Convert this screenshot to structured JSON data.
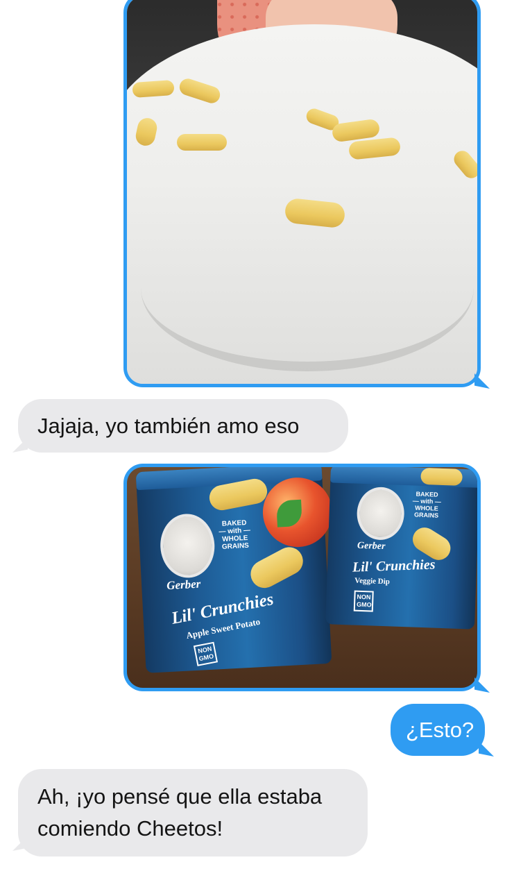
{
  "conversation": {
    "messages": [
      {
        "side": "outgoing",
        "type": "photo",
        "label": ""
      },
      {
        "side": "incoming",
        "type": "text",
        "text": "Jajaja, yo también amo eso"
      },
      {
        "side": "outgoing",
        "type": "photo",
        "label": ""
      },
      {
        "side": "outgoing",
        "type": "text",
        "text": "¿Esto?"
      },
      {
        "side": "incoming",
        "type": "text",
        "text": "Ah, ¡yo pensé que ella estaba comiendo Cheetos!"
      }
    ]
  },
  "product_photo": {
    "left_can": {
      "brand": "Gerber",
      "badge": "BAKED\n— with —\nWHOLE\nGRAINS",
      "product_name": "Lil' Crunchies",
      "flavor": "Apple Sweet Potato",
      "nongmo": "NON\nGMO"
    },
    "right_can": {
      "brand": "Gerber",
      "badge": "BAKED\n— with —\nWHOLE\nGRAINS",
      "product_name": "Lil' Crunchies",
      "flavor": "Veggie Dip",
      "nongmo": "NON\nGMO"
    }
  },
  "colors": {
    "outgoing_bubble": "#2f9cf2",
    "incoming_bubble": "#e9e9eb",
    "incoming_text": "#141414",
    "outgoing_text": "#ffffff"
  }
}
